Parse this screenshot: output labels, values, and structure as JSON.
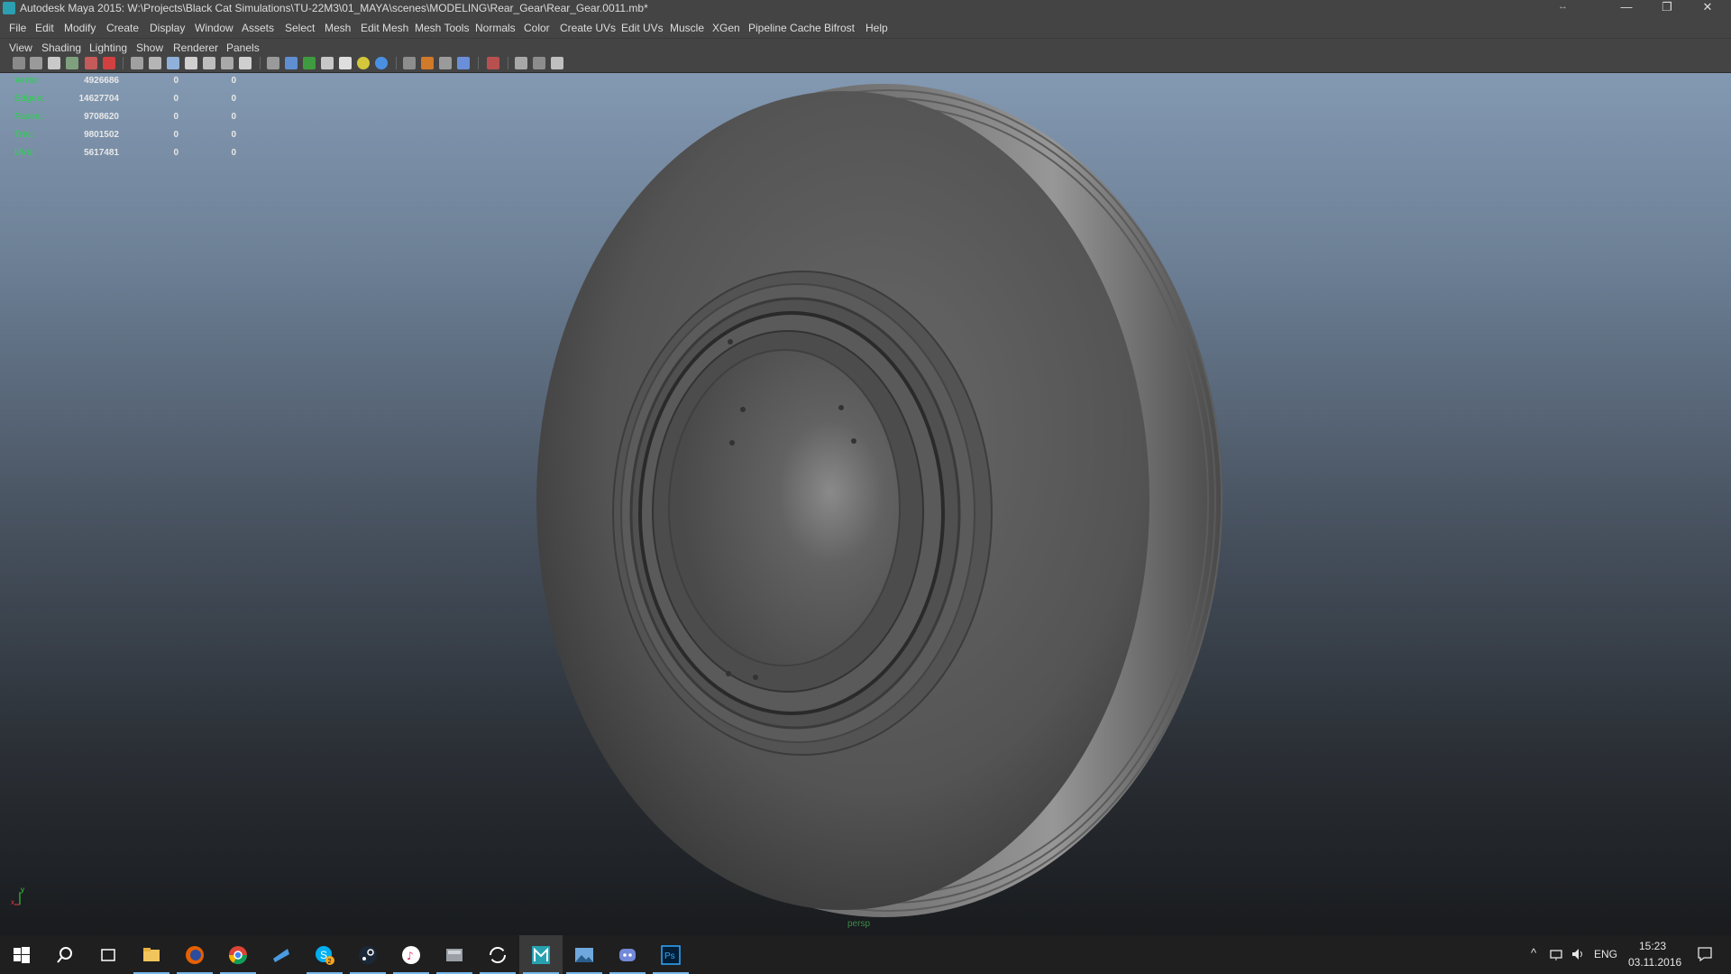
{
  "window": {
    "title": "Autodesk Maya 2015: W:\\Projects\\Black Cat Simulations\\TU-22M3\\01_MAYA\\scenes\\MODELING\\Rear_Gear\\Rear_Gear.0011.mb*",
    "minimize": "—",
    "restore": "❐",
    "close": "✕",
    "resize_glyph": "↔"
  },
  "menubar": [
    "File",
    "Edit",
    "Modify",
    "Create",
    "Display",
    "Window",
    "Assets",
    "Select",
    "Mesh",
    "Edit Mesh",
    "Mesh Tools",
    "Normals",
    "Color",
    "Create UVs",
    "Edit UVs",
    "Muscle",
    "XGen",
    "Pipeline Cache",
    "Bifrost",
    "Help"
  ],
  "panel_menu": [
    "View",
    "Shading",
    "Lighting",
    "Show",
    "Renderer",
    "Panels"
  ],
  "hud": {
    "rows": [
      {
        "label": "Verts:",
        "v1": "4926686",
        "v2": "0",
        "v3": "0"
      },
      {
        "label": "Edges:",
        "v1": "14627704",
        "v2": "0",
        "v3": "0"
      },
      {
        "label": "Faces:",
        "v1": "9708620",
        "v2": "0",
        "v3": "0"
      },
      {
        "label": "Tris:",
        "v1": "9801502",
        "v2": "0",
        "v3": "0"
      },
      {
        "label": "UVs:",
        "v1": "5617481",
        "v2": "0",
        "v3": "0"
      }
    ]
  },
  "viewport": {
    "camera": "persp",
    "axis_y": "y",
    "axis_x": "x"
  },
  "taskbar": {
    "apps": [
      "start",
      "search",
      "task-view",
      "file-explorer",
      "firefox",
      "chrome",
      "app-blue",
      "skype",
      "steam",
      "itunes",
      "app-gray",
      "sync",
      "maya",
      "photos",
      "discord",
      "photoshop"
    ],
    "skype_badge": "2",
    "ps_label": "Ps",
    "lang": "ENG",
    "time": "15:23",
    "date": "03.11.2016",
    "tray_chevron": "^"
  }
}
